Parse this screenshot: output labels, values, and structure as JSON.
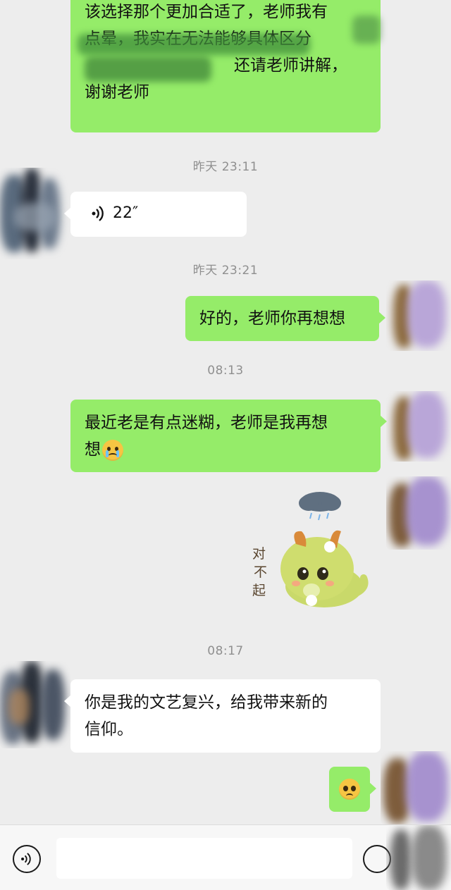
{
  "messages": {
    "m1": {
      "lines": [
        "该选择那个更加合适了，老师我有",
        "点晕，我实在无法能够具体区分",
        "还请老师讲解，",
        "谢谢老师"
      ]
    },
    "ts1": "昨天 23:11",
    "voice": {
      "duration": "22″"
    },
    "ts2": "昨天 23:21",
    "m2": {
      "text": "好的，老师你再想想"
    },
    "ts3": "08:13",
    "m3": {
      "line1": "最近老是有点迷糊，老师是我再想",
      "line2": "想"
    },
    "sticker": {
      "text_lines": [
        "对",
        "不",
        "起"
      ],
      "icon": "sorry-sticker"
    },
    "ts4": "08:17",
    "m4": {
      "line1": "你是我的文艺复兴，给我带来新的",
      "line2": "信仰。"
    },
    "m5": {
      "emoji": "pleading-face"
    }
  },
  "colors": {
    "outgoing": "#95ec69",
    "incoming": "#ffffff",
    "background": "#ededed",
    "timestamp": "#8f8f8f"
  },
  "icons": {
    "voice_toggle": "voice-icon",
    "emoji_button": "emoji-icon"
  }
}
